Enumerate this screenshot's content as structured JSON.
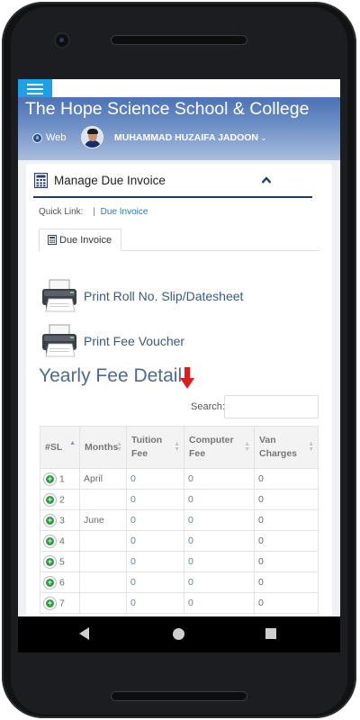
{
  "header": {
    "school_title": "The Hope Science School & College",
    "web_label": "Web",
    "user_name": "MUHAMMAD HUZAIFA JADOON",
    "user_caret": "⌄"
  },
  "card": {
    "title": "Manage Due Invoice",
    "collapse_icon": "^"
  },
  "quick_link": {
    "label": "Quick Link:",
    "separator": "|",
    "link": "Due Invoice"
  },
  "tab": {
    "label": "Due Invoice"
  },
  "actions": {
    "print_roll": "Print Roll No. Slip/Datesheet",
    "print_fee": "Print Fee Voucher"
  },
  "section_title": "Yearly Fee Detail",
  "search": {
    "label": "Search:",
    "value": ""
  },
  "table": {
    "headers": [
      "#SL",
      "Months",
      "Tuition Fee",
      "Computer Fee",
      "Van Charges"
    ],
    "rows": [
      {
        "sl": "1",
        "month": "April",
        "tuition": "0",
        "computer": "0",
        "van": "0"
      },
      {
        "sl": "2",
        "month": "",
        "tuition": "0",
        "computer": "0",
        "van": "0"
      },
      {
        "sl": "3",
        "month": "June",
        "tuition": "0",
        "computer": "0",
        "van": "0"
      },
      {
        "sl": "4",
        "month": "",
        "tuition": "0",
        "computer": "0",
        "van": "0"
      },
      {
        "sl": "5",
        "month": "",
        "tuition": "0",
        "computer": "0",
        "van": "0"
      },
      {
        "sl": "6",
        "month": "",
        "tuition": "0",
        "computer": "0",
        "van": "0"
      },
      {
        "sl": "7",
        "month": "",
        "tuition": "0",
        "computer": "0",
        "van": "0"
      }
    ]
  },
  "icons": {
    "menu": "menu-icon",
    "globe": "globe-icon",
    "calculator": "calculator-icon",
    "printer": "printer-icon",
    "arrow": "red-down-arrow-icon",
    "expand_row": "plus-circle-icon"
  },
  "colors": {
    "menu_button": "#1da1e6",
    "header_gradient_top": "#4b72b4",
    "title_text": "#4e6a93",
    "link": "#2a7ab8",
    "expand_button": "#2e9a44",
    "arrow": "#e01b1b"
  }
}
